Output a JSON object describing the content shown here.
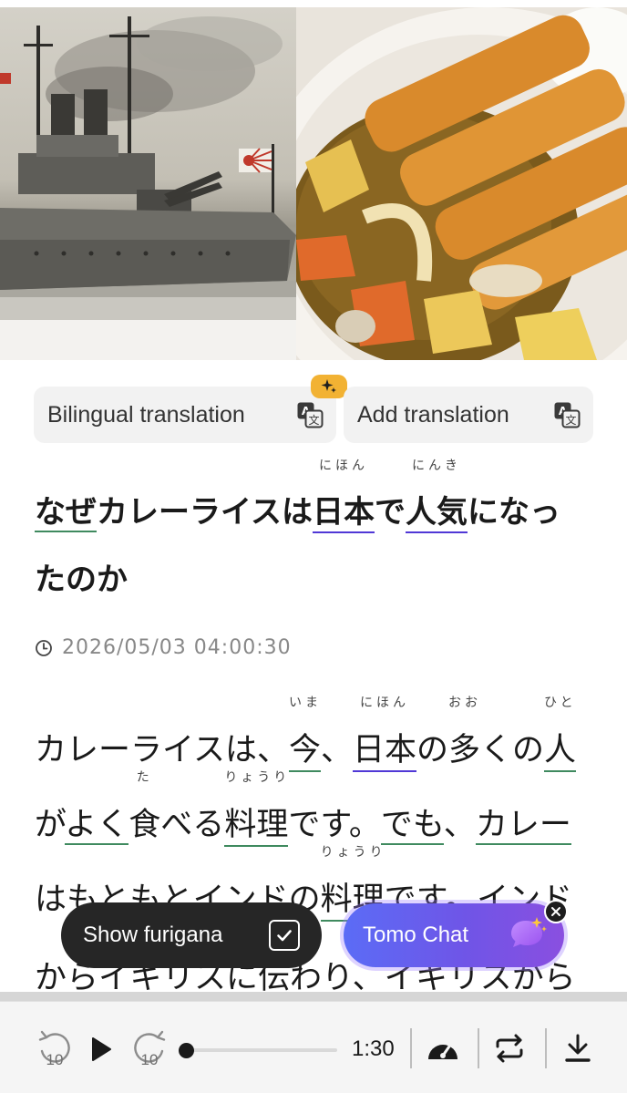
{
  "translation_buttons": {
    "bilingual_label": "Bilingual translation",
    "add_label": "Add translation"
  },
  "article": {
    "title": {
      "line1": [
        {
          "text": "なぜ",
          "underline": "green"
        },
        {
          "text": "カレーライスは"
        },
        {
          "text": "日本",
          "ruby": "にほん",
          "underline": "purple"
        },
        {
          "text": "で"
        },
        {
          "text": "人気",
          "ruby": "にんき",
          "underline": "purple"
        },
        {
          "text": "になっ"
        }
      ],
      "line2": [
        {
          "text": "たのか"
        }
      ]
    },
    "timestamp": "2026/05/03 04:00:30",
    "body": {
      "line1": [
        {
          "text": "カレーライスは、"
        },
        {
          "text": "今",
          "ruby": "いま",
          "underline": "green"
        },
        {
          "text": "、"
        },
        {
          "text": "日本",
          "ruby": "にほん",
          "underline": "purple"
        },
        {
          "text": "の"
        },
        {
          "text": "多",
          "ruby": "おお"
        },
        {
          "text": "くの"
        },
        {
          "text": "人",
          "ruby": "ひと",
          "underline": "green"
        }
      ],
      "line2": [
        {
          "text": "が"
        },
        {
          "text": "よく",
          "underline": "green"
        },
        {
          "text": "食",
          "ruby": "た"
        },
        {
          "text": "べる"
        },
        {
          "text": "料理",
          "ruby": "りょうり",
          "underline": "green"
        },
        {
          "text": "です。"
        },
        {
          "text": "でも",
          "underline": "green"
        },
        {
          "text": "、"
        },
        {
          "text": "カレー",
          "underline": "green"
        }
      ],
      "line3": [
        {
          "text": "はもともとインドの"
        },
        {
          "text": "料理",
          "ruby": "りょうり",
          "underline": "green"
        },
        {
          "text": "です。インド"
        }
      ],
      "line4": [
        {
          "text": "からイギリスに伝わり、イギリスから"
        }
      ]
    }
  },
  "furigana_toggle": {
    "label": "Show furigana",
    "checked": true
  },
  "tomo_chat": {
    "label": "Tomo Chat"
  },
  "player": {
    "rewind_label": "10",
    "forward_label": "10",
    "time": "1:30",
    "progress": 0.0
  },
  "icons": {
    "clock": "clock-icon",
    "translate": "translate-icon",
    "sparkle": "sparkle-icon",
    "chat": "chat-bubble-icon",
    "close": "close-icon",
    "rewind": "rewind-10-icon",
    "play": "play-icon",
    "forward": "forward-10-icon",
    "speed": "speedometer-icon",
    "repeat": "repeat-icon",
    "download": "download-icon"
  },
  "colors": {
    "underline_green": "#3f8a5f",
    "underline_purple": "#5038d6",
    "badge_yellow": "#f2b233",
    "chat_gradient_start": "#5b6cf6",
    "chat_gradient_end": "#8a4fe0"
  }
}
